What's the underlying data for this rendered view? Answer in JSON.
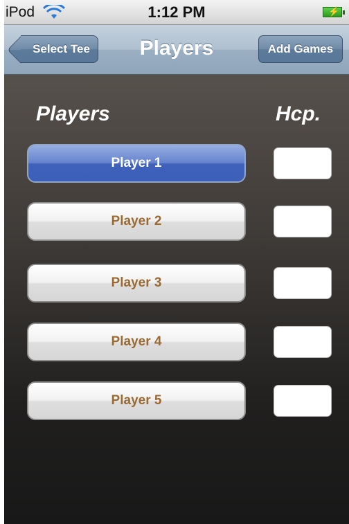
{
  "status_bar": {
    "carrier": "iPod",
    "time": "1:12 PM",
    "wifi_icon": "wifi-icon",
    "battery_icon": "battery-charging-icon"
  },
  "nav": {
    "back_label": "Select Tee",
    "title": "Players",
    "right_label": "Add Games"
  },
  "headers": {
    "players": "Players",
    "hcp": "Hcp."
  },
  "players": [
    {
      "label": "Player 1",
      "selected": true,
      "hcp": ""
    },
    {
      "label": "Player 2",
      "selected": false,
      "hcp": ""
    },
    {
      "label": "Player 3",
      "selected": false,
      "hcp": ""
    },
    {
      "label": "Player 4",
      "selected": false,
      "hcp": ""
    },
    {
      "label": "Player 5",
      "selected": false,
      "hcp": ""
    }
  ],
  "colors": {
    "selected_button": "#4a6cc4",
    "unselected_text": "#9a6a32",
    "nav_bar": "#a3b6c9"
  }
}
